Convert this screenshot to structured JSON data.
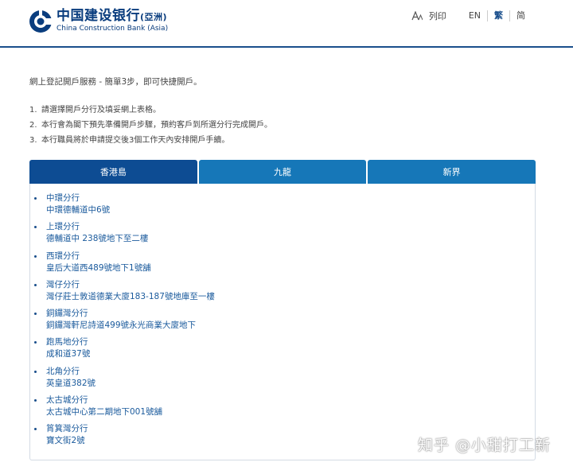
{
  "header": {
    "logo_cn": "中国建设银行",
    "logo_cn_sub": "(亞洲)",
    "logo_en": "China Construction Bank (Asia)",
    "print_label": "列印",
    "languages": [
      "EN",
      "繁",
      "简"
    ],
    "active_language": "繁"
  },
  "intro": "網上登記開戶服務 - 簡單3步，即可快捷開戶。",
  "steps": [
    {
      "num": "1.",
      "text": "請選擇開戶分行及填妥網上表格。"
    },
    {
      "num": "2.",
      "text": "本行會為閣下預先準備開戶步驟，預約客戶到所選分行完成開戶。"
    },
    {
      "num": "3.",
      "text": "本行職員將於申請提交後3個工作天內安排開戶手續。"
    }
  ],
  "tabs": [
    {
      "label": "香港島",
      "active": true
    },
    {
      "label": "九龍",
      "active": false
    },
    {
      "label": "新界",
      "active": false
    }
  ],
  "branches": [
    {
      "name": "中環分行",
      "address": "中環德輔道中6號"
    },
    {
      "name": "上環分行",
      "address": "德輔道中 238號地下至二樓"
    },
    {
      "name": "西環分行",
      "address": "皇后大道西489號地下1號舖"
    },
    {
      "name": "灣仔分行",
      "address": "灣仔莊士敦道德業大廈183-187號地庫至一樓"
    },
    {
      "name": "銅鑼灣分行",
      "address": "銅鑼灣軒尼詩道499號永光商業大廈地下"
    },
    {
      "name": "跑馬地分行",
      "address": "成和道37號"
    },
    {
      "name": "北角分行",
      "address": "英皇道382號"
    },
    {
      "name": "太古城分行",
      "address": "太古城中心第二期地下001號舖"
    },
    {
      "name": "筲箕灣分行",
      "address": "寶文街2號"
    }
  ],
  "watermark": "知乎 @小甜打工新",
  "colors": {
    "brand": "#0a3d7e",
    "tab": "#1677b8",
    "tab_active": "#0d4c93",
    "link": "#1a5a9c"
  }
}
